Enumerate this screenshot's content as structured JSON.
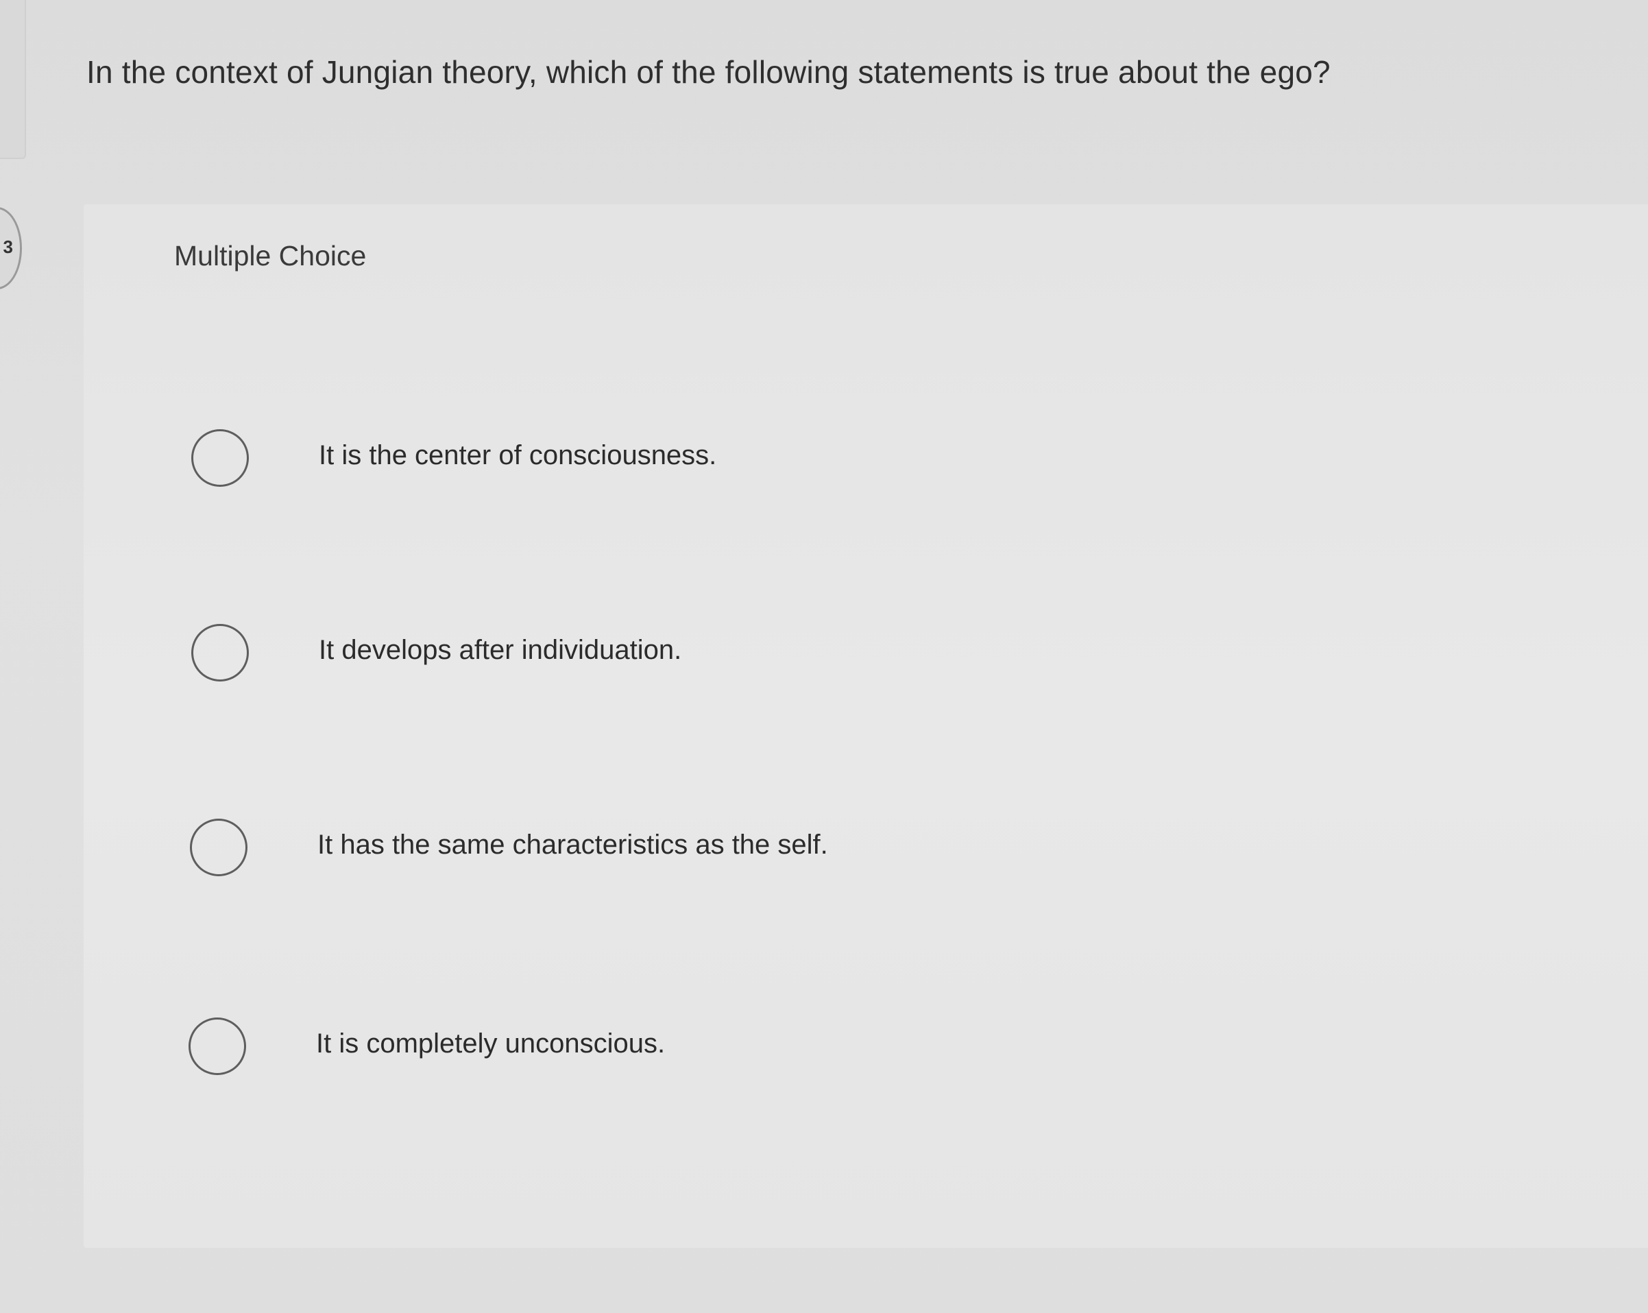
{
  "question": {
    "number": "3",
    "prompt": "In the context of Jungian theory, which of the following statements is true about the ego?",
    "type_label": "Multiple Choice"
  },
  "choices": [
    {
      "label": "It is the center of consciousness.",
      "selected": false
    },
    {
      "label": "It develops after individuation.",
      "selected": false
    },
    {
      "label": "It has the same characteristics as the self.",
      "selected": false
    },
    {
      "label": "It is completely unconscious.",
      "selected": false
    }
  ]
}
